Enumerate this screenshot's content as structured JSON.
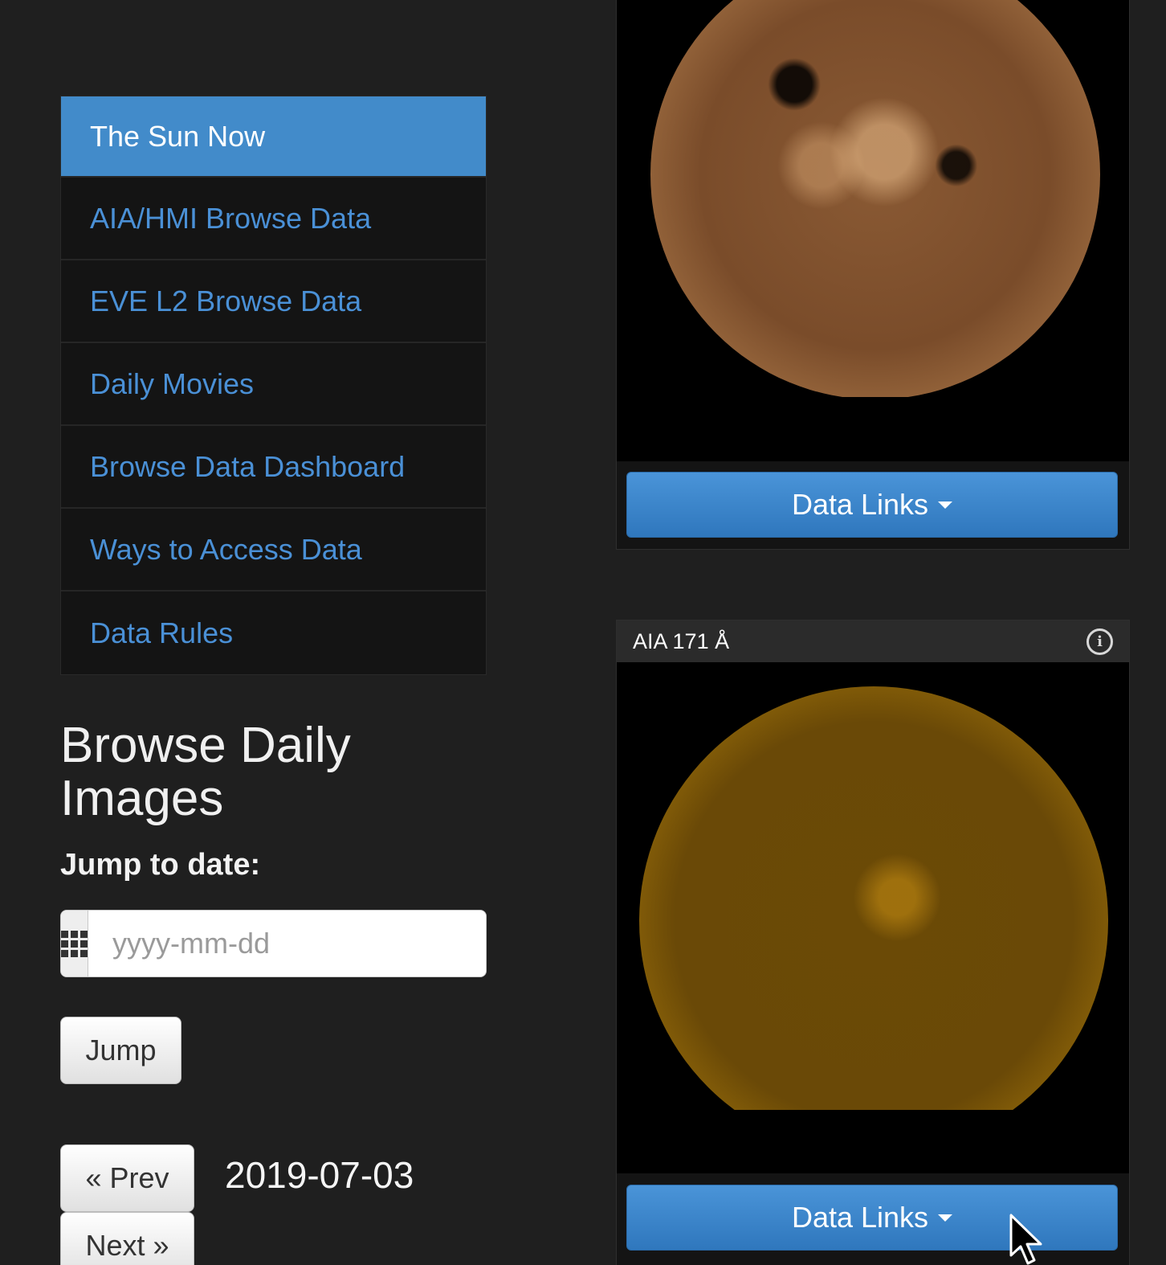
{
  "nav": {
    "items": [
      {
        "label": "The Sun Now",
        "active": true
      },
      {
        "label": "AIA/HMI Browse Data"
      },
      {
        "label": "EVE L2 Browse Data"
      },
      {
        "label": "Daily Movies"
      },
      {
        "label": "Browse Data Dashboard"
      },
      {
        "label": "Ways to Access Data"
      },
      {
        "label": "Data Rules"
      }
    ]
  },
  "browse": {
    "heading": "Browse Daily Images",
    "jump_label": "Jump to date:",
    "date_placeholder": "yyyy-mm-dd",
    "jump_button": "Jump",
    "prev_button": "« Prev",
    "next_button": "Next »",
    "current_date": "2019-07-03"
  },
  "panels": [
    {
      "data_links_label": "Data Links"
    },
    {
      "title": "AIA 171 Å",
      "data_links_label": "Data Links"
    }
  ],
  "colors": {
    "accent": "#428bca",
    "link": "#4a90d6",
    "background": "#1f1f1f"
  }
}
